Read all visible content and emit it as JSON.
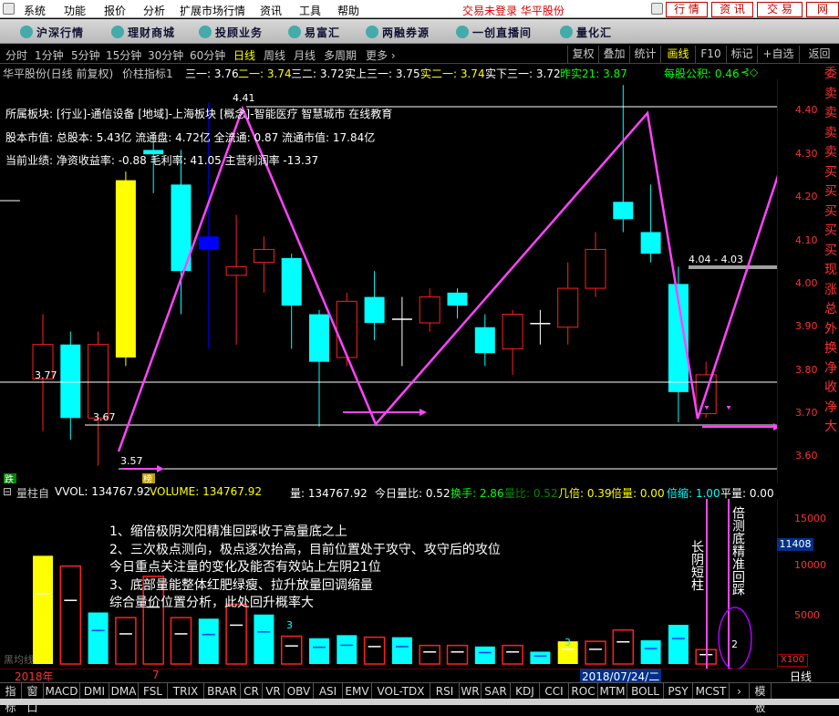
{
  "menu": {
    "items": [
      "系统",
      "功能",
      "报价",
      "分析",
      "扩展市场行情",
      "资讯",
      "工具",
      "帮助"
    ],
    "status": "交易未登录 华平股份",
    "trade_tabs": [
      "行 情",
      "资 讯",
      "交 易",
      "网"
    ]
  },
  "nav": {
    "items": [
      "沪深行情",
      "理财商城",
      "投顾业务",
      "易富汇",
      "两融券源",
      "一创直播间",
      "量化汇"
    ]
  },
  "periods": {
    "left": [
      "分时",
      "1分钟",
      "5分钟",
      "15分钟",
      "30分钟",
      "60分钟",
      "日线",
      "周线",
      "月线",
      "多周期",
      "更多 ›"
    ],
    "active": "日线",
    "right": [
      "复权",
      "叠加",
      "统计",
      "画线",
      "F10",
      "标记",
      "+自选",
      "返回"
    ],
    "right_active": "画线"
  },
  "info": {
    "title": "华平股份(日线 前复权)",
    "ind": "价柱指标1",
    "s1": "三一: 3.76",
    "s2": "二一: 3.74",
    "s3": "三二: 3.72",
    "s4": "实上三一: 3.75",
    "s5": "实二一: 3.74",
    "s6": "实下三一: 3.72",
    "s7": "昨实21: 3.87",
    "s8": "每股公积: 0.46"
  },
  "overlay": {
    "line1": "所属板块: [行业]-通信设备 [地域]-上海板块 [概念]-智能医疗 智慧城市 在线教育",
    "line2": "股本市值: 总股本: 5.43亿 流通盘: 4.72亿 全流通: 0.87 流通市值: 17.84亿",
    "line3": "当前业绩: 净资收益率: -0.88 毛利率: 41.05 主营利润率 -13.37"
  },
  "price_labels": {
    "high": "4.41",
    "l1": "3.77",
    "l2": "3.67",
    "l3": "3.57",
    "range": "4.04 - 4.03",
    "die": "跌",
    "bang": "榜"
  },
  "axis": {
    "prices": [
      "4.40",
      "4.30",
      "4.20",
      "4.10",
      "4.00",
      "3.90",
      "3.80",
      "3.70",
      "3.60"
    ],
    "vol": [
      "15000",
      "10000",
      "5000"
    ],
    "vol_hl": "11408",
    "x100": "X100"
  },
  "side_text": [
    "委",
    "卖",
    "卖",
    "卖",
    "卖",
    "买",
    "买",
    "买",
    "买",
    "买",
    "现",
    "涨",
    "总",
    "外",
    "换",
    "净",
    "收",
    "净",
    "大"
  ],
  "vol_header": {
    "name": "量柱自",
    "vvol": "VVOL: 134767.92",
    "volume": "VOLUME: 134767.92",
    "liang": "量: 134767.92",
    "jrlb": "今日量比: 0.52",
    "hs": "换手: 2.86",
    "lb": "量比: 0.52",
    "jb": "几倍: 0.39",
    "bl": "倍量: 0.00",
    "bs": "倍缩: 1.00",
    "pt": "平量: 0.00"
  },
  "annotation": [
    "1、缩倍极阴次阳精准回踩收于高量底之上",
    "2、三次极点测向，极点逐次抬高，目前位置处于攻守、攻守后的攻位",
    "今日重点关注量的变化及能否有效站上左阴21位",
    "3、底部量能整体红肥绿瘦、拉升放量回调缩量",
    "综合量价位置分析，此处回升概率大"
  ],
  "vert_text": {
    "a": "长阴短柱",
    "b": "倍测底精准回踩"
  },
  "dates": {
    "y": "2018年",
    "m": "7",
    "d": "2018/07/24/二",
    "day": "日线"
  },
  "small": {
    "l1": "3",
    "l2": "3",
    "l3": "2",
    "ypj": "黑均线"
  },
  "tabs": [
    "指标",
    "窗口",
    "MACD",
    "DMI",
    "DMA",
    "FSL",
    "TRIX",
    "BRAR",
    "CR",
    "VR",
    "OBV",
    "ASI",
    "EMV",
    "VOL-TDX",
    "RSI",
    "WR",
    "SAR",
    "KDJ",
    "CCI",
    "ROC",
    "MTM",
    "BOLL",
    "PSY",
    "MCST",
    "›",
    "模板"
  ],
  "colors": {
    "up": "#ff2020",
    "down": "#00ffff",
    "bg": "#000000",
    "line": "#ff44ff",
    "yellow": "#ffff00"
  },
  "candles": [
    {
      "o": 3.77,
      "c": 3.85,
      "h": 3.92,
      "l": 3.65,
      "t": "up"
    },
    {
      "o": 3.85,
      "c": 3.68,
      "h": 3.88,
      "l": 3.63,
      "t": "down"
    },
    {
      "o": 3.68,
      "c": 3.85,
      "h": 3.88,
      "l": 3.57,
      "t": "up"
    },
    {
      "o": 3.82,
      "c": 4.23,
      "h": 4.25,
      "l": 3.8,
      "t": "ys"
    },
    {
      "o": 4.3,
      "c": 4.29,
      "h": 4.33,
      "l": 4.2,
      "t": "down"
    },
    {
      "o": 4.22,
      "c": 4.02,
      "h": 4.3,
      "l": 3.92,
      "t": "down"
    },
    {
      "o": 4.1,
      "c": 4.07,
      "h": 4.41,
      "l": 3.84,
      "t": "blue"
    },
    {
      "o": 4.01,
      "c": 4.03,
      "h": 4.15,
      "l": 3.85,
      "t": "up"
    },
    {
      "o": 4.04,
      "c": 4.07,
      "h": 4.1,
      "l": 3.97,
      "t": "up"
    },
    {
      "o": 4.05,
      "c": 3.94,
      "h": 4.06,
      "l": 3.84,
      "t": "down"
    },
    {
      "o": 3.92,
      "c": 3.81,
      "h": 3.93,
      "l": 3.66,
      "t": "down"
    },
    {
      "o": 3.82,
      "c": 3.95,
      "h": 3.97,
      "l": 3.8,
      "t": "up"
    },
    {
      "o": 3.96,
      "c": 3.9,
      "h": 4.02,
      "l": 3.86,
      "t": "down"
    },
    {
      "o": 3.91,
      "c": 3.91,
      "h": 3.96,
      "l": 3.8,
      "t": "flat"
    },
    {
      "o": 3.9,
      "c": 3.96,
      "h": 3.98,
      "l": 3.88,
      "t": "up"
    },
    {
      "o": 3.97,
      "c": 3.94,
      "h": 3.98,
      "l": 3.91,
      "t": "down"
    },
    {
      "o": 3.89,
      "c": 3.83,
      "h": 3.92,
      "l": 3.8,
      "t": "down"
    },
    {
      "o": 3.84,
      "c": 3.92,
      "h": 3.93,
      "l": 3.78,
      "t": "up"
    },
    {
      "o": 3.9,
      "c": 3.9,
      "h": 3.93,
      "l": 3.85,
      "t": "flat"
    },
    {
      "o": 3.89,
      "c": 3.98,
      "h": 4.04,
      "l": 3.85,
      "t": "up"
    },
    {
      "o": 3.98,
      "c": 4.07,
      "h": 4.11,
      "l": 3.96,
      "t": "up"
    },
    {
      "o": 4.18,
      "c": 4.14,
      "h": 4.45,
      "l": 4.11,
      "t": "down"
    },
    {
      "o": 4.11,
      "c": 4.06,
      "h": 4.22,
      "l": 4.04,
      "t": "down"
    },
    {
      "o": 3.99,
      "c": 3.74,
      "h": 4.03,
      "l": 3.67,
      "t": "down"
    },
    {
      "o": 3.69,
      "c": 3.78,
      "h": 3.81,
      "l": 3.68,
      "t": "up"
    }
  ],
  "volumes": [
    {
      "v": 10500,
      "t": "ys"
    },
    {
      "v": 9500,
      "t": "up"
    },
    {
      "v": 5000,
      "t": "down"
    },
    {
      "v": 4500,
      "t": "up"
    },
    {
      "v": 8500,
      "t": "up"
    },
    {
      "v": 4500,
      "t": "up"
    },
    {
      "v": 4400,
      "t": "down"
    },
    {
      "v": 5800,
      "t": "up"
    },
    {
      "v": 4800,
      "t": "down"
    },
    {
      "v": 2700,
      "t": "up"
    },
    {
      "v": 2500,
      "t": "down"
    },
    {
      "v": 2800,
      "t": "down"
    },
    {
      "v": 2600,
      "t": "up"
    },
    {
      "v": 2600,
      "t": "down"
    },
    {
      "v": 1800,
      "t": "up"
    },
    {
      "v": 1800,
      "t": "up"
    },
    {
      "v": 1700,
      "t": "down"
    },
    {
      "v": 1800,
      "t": "up"
    },
    {
      "v": 1200,
      "t": "down"
    },
    {
      "v": 2200,
      "t": "ys"
    },
    {
      "v": 2200,
      "t": "up"
    },
    {
      "v": 3300,
      "t": "up"
    },
    {
      "v": 2300,
      "t": "down"
    },
    {
      "v": 3800,
      "t": "down"
    },
    {
      "v": 1400,
      "t": "up"
    }
  ]
}
